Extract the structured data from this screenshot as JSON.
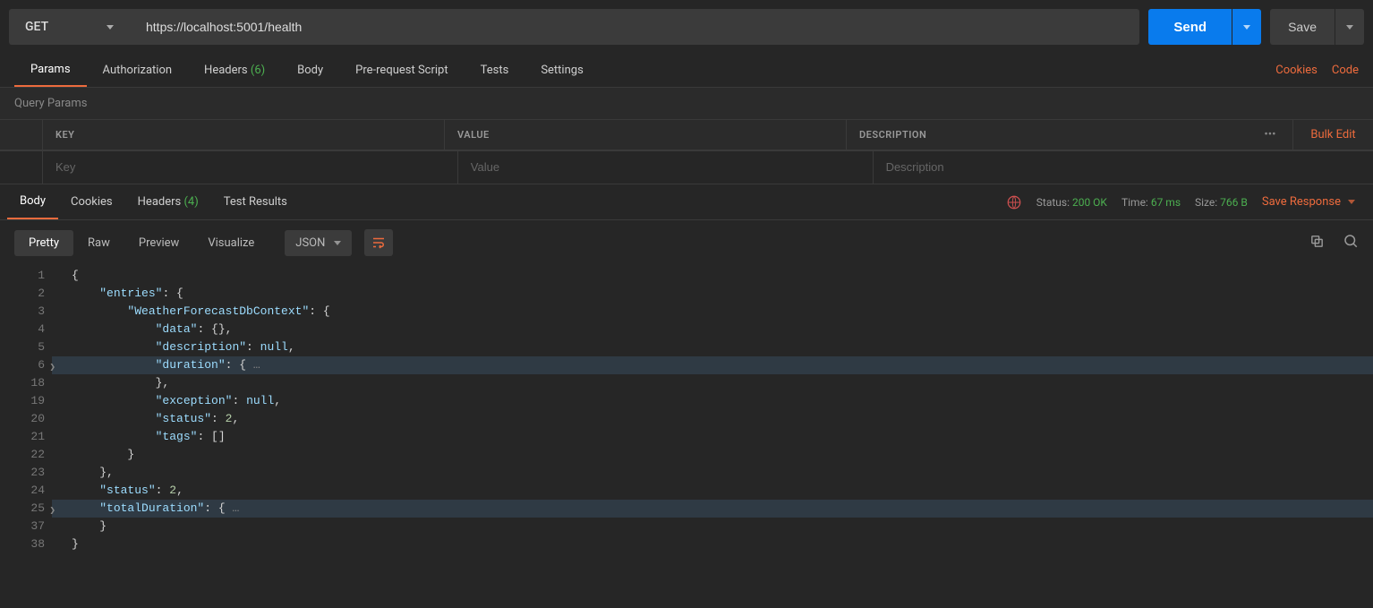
{
  "request": {
    "method": "GET",
    "url": "https://localhost:5001/health",
    "send_label": "Send",
    "save_label": "Save"
  },
  "request_tabs": {
    "params": "Params",
    "authorization": "Authorization",
    "headers_label": "Headers",
    "headers_count": "(6)",
    "body": "Body",
    "prerequest": "Pre-request Script",
    "tests": "Tests",
    "settings": "Settings",
    "cookies_link": "Cookies",
    "code_link": "Code"
  },
  "query_params": {
    "title": "Query Params",
    "key_header": "KEY",
    "value_header": "VALUE",
    "description_header": "DESCRIPTION",
    "bulk_edit": "Bulk Edit",
    "key_placeholder": "Key",
    "value_placeholder": "Value",
    "description_placeholder": "Description"
  },
  "response_tabs": {
    "body": "Body",
    "cookies": "Cookies",
    "headers_label": "Headers",
    "headers_count": "(4)",
    "test_results": "Test Results",
    "status_label": "Status:",
    "status_value": "200 OK",
    "time_label": "Time:",
    "time_value": "67 ms",
    "size_label": "Size:",
    "size_value": "766 B",
    "save_response": "Save Response"
  },
  "view_modes": {
    "pretty": "Pretty",
    "raw": "Raw",
    "preview": "Preview",
    "visualize": "Visualize",
    "format": "JSON"
  },
  "response_body": {
    "lines": [
      {
        "n": "1",
        "indent": 0,
        "folded": false,
        "html": "<span class='tok-punc'>{</span>"
      },
      {
        "n": "2",
        "indent": 1,
        "folded": false,
        "html": "<span class='tok-key'>\"entries\"</span><span class='tok-punc'>: {</span>"
      },
      {
        "n": "3",
        "indent": 2,
        "folded": false,
        "html": "<span class='tok-key'>\"WeatherForecastDbContext\"</span><span class='tok-punc'>: {</span>"
      },
      {
        "n": "4",
        "indent": 3,
        "folded": false,
        "html": "<span class='tok-key'>\"data\"</span><span class='tok-punc'>: {},</span>"
      },
      {
        "n": "5",
        "indent": 3,
        "folded": false,
        "html": "<span class='tok-key'>\"description\"</span><span class='tok-punc'>: </span><span class='tok-null'>null</span><span class='tok-punc'>,</span>"
      },
      {
        "n": "6",
        "indent": 3,
        "folded": true,
        "expand": true,
        "html": "<span class='tok-key'>\"duration\"</span><span class='tok-punc'>: {</span> <span class='tok-fold'>…</span>"
      },
      {
        "n": "18",
        "indent": 3,
        "folded": false,
        "html": "<span class='tok-punc'>},</span>"
      },
      {
        "n": "19",
        "indent": 3,
        "folded": false,
        "html": "<span class='tok-key'>\"exception\"</span><span class='tok-punc'>: </span><span class='tok-null'>null</span><span class='tok-punc'>,</span>"
      },
      {
        "n": "20",
        "indent": 3,
        "folded": false,
        "html": "<span class='tok-key'>\"status\"</span><span class='tok-punc'>: </span><span class='tok-num'>2</span><span class='tok-punc'>,</span>"
      },
      {
        "n": "21",
        "indent": 3,
        "folded": false,
        "html": "<span class='tok-key'>\"tags\"</span><span class='tok-punc'>: []</span>"
      },
      {
        "n": "22",
        "indent": 2,
        "folded": false,
        "html": "<span class='tok-punc'>}</span>"
      },
      {
        "n": "23",
        "indent": 1,
        "folded": false,
        "html": "<span class='tok-punc'>},</span>"
      },
      {
        "n": "24",
        "indent": 1,
        "folded": false,
        "html": "<span class='tok-key'>\"status\"</span><span class='tok-punc'>: </span><span class='tok-num'>2</span><span class='tok-punc'>,</span>"
      },
      {
        "n": "25",
        "indent": 1,
        "folded": true,
        "expand": true,
        "html": "<span class='tok-key'>\"totalDuration\"</span><span class='tok-punc'>: {</span> <span class='tok-fold'>…</span>"
      },
      {
        "n": "37",
        "indent": 1,
        "folded": false,
        "html": "<span class='tok-punc'>}</span>"
      },
      {
        "n": "38",
        "indent": 0,
        "folded": false,
        "html": "<span class='tok-punc'>}</span>"
      }
    ]
  }
}
